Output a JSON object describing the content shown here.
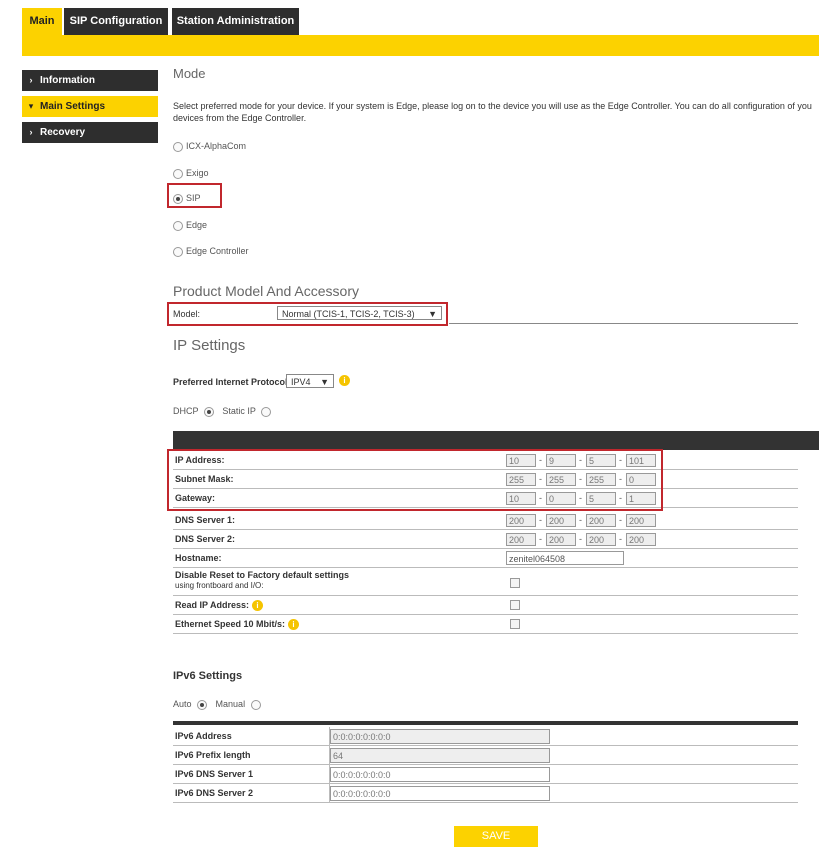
{
  "tabs": [
    "Main",
    "SIP Configuration",
    "Station Administration"
  ],
  "sidebar": {
    "items": [
      {
        "label": "Information",
        "chevron": "›",
        "active": false
      },
      {
        "label": "Main Settings",
        "chevron": "▾",
        "active": true
      },
      {
        "label": "Recovery",
        "chevron": "›",
        "active": false
      }
    ]
  },
  "mode": {
    "title": "Mode",
    "description": "Select preferred mode for your device. If your system is Edge, please log on to the device you will use as the Edge Controller. You can do all configuration of you devices from the Edge Controller.",
    "options": [
      "ICX-AlphaCom",
      "Exigo",
      "SIP",
      "Edge",
      "Edge Controller"
    ],
    "selected": "SIP"
  },
  "product": {
    "title": "Product Model And Accessory",
    "model_label": "Model:",
    "model_value": "Normal (TCIS-1, TCIS-2, TCIS-3)"
  },
  "ip": {
    "title": "IP Settings",
    "protocol_label": "Preferred Internet Protocol",
    "protocol_value": "IPV4",
    "dhcp_label": "DHCP",
    "static_label": "Static IP",
    "selected": "DHCP",
    "rows": [
      {
        "label": "IP Address:",
        "octets": [
          "10",
          "9",
          "5",
          "101"
        ]
      },
      {
        "label": "Subnet Mask:",
        "octets": [
          "255",
          "255",
          "255",
          "0"
        ]
      },
      {
        "label": "Gateway:",
        "octets": [
          "10",
          "0",
          "5",
          "1"
        ]
      },
      {
        "label": "DNS Server 1:",
        "octets": [
          "200",
          "200",
          "200",
          "200"
        ]
      },
      {
        "label": "DNS Server 2:",
        "octets": [
          "200",
          "200",
          "200",
          "200"
        ]
      }
    ],
    "hostname_label": "Hostname:",
    "hostname_value": "zenitel064508",
    "disable_reset_label_1": "Disable Reset to Factory default settings",
    "disable_reset_label_2": "using frontboard and I/O:",
    "read_ip_label": "Read IP Address:",
    "ethernet_label": "Ethernet Speed 10 Mbit/s:"
  },
  "ipv6": {
    "title": "IPv6 Settings",
    "auto_label": "Auto",
    "manual_label": "Manual",
    "selected": "Auto",
    "rows": [
      {
        "label": "IPv6 Address",
        "value": "0:0:0:0:0:0:0:0"
      },
      {
        "label": "IPv6 Prefix length",
        "value": "64"
      },
      {
        "label": "IPv6 DNS Server 1",
        "value": "0:0:0:0:0:0:0:0"
      },
      {
        "label": "IPv6 DNS Server 2",
        "value": "0:0:0:0:0:0:0:0"
      }
    ]
  },
  "save_label": "SAVE",
  "colors": {
    "accent": "#fcd200",
    "dark": "#2e2e2e",
    "highlight": "#c1272d"
  }
}
